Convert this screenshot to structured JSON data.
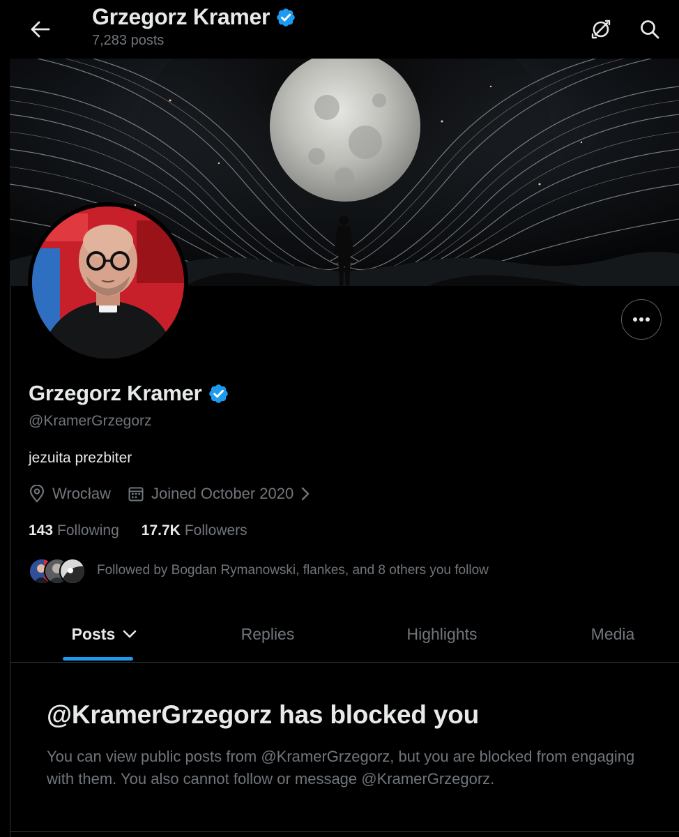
{
  "header": {
    "name": "Grzegorz Kramer",
    "post_count": "7,283 posts"
  },
  "profile": {
    "display_name": "Grzegorz Kramer",
    "handle": "@KramerGrzegorz",
    "bio": "jezuita prezbiter",
    "location": "Wrocław",
    "joined": "Joined October 2020",
    "following_count": "143",
    "following_label": "Following",
    "followers_count": "17.7K",
    "followers_label": "Followers",
    "followed_by": "Followed by Bogdan Rymanowski, flankes, and 8 others you follow",
    "verified": true
  },
  "tabs": [
    {
      "label": "Posts",
      "active": true
    },
    {
      "label": "Replies",
      "active": false
    },
    {
      "label": "Highlights",
      "active": false
    },
    {
      "label": "Media",
      "active": false
    }
  ],
  "blocked": {
    "title": "@KramerGrzegorz has blocked you",
    "message": "You can view public posts from @KramerGrzegorz, but you are blocked from engaging with them. You also cannot follow or message @KramerGrzegorz."
  },
  "colors": {
    "background": "#000000",
    "text_primary": "#e7e9ea",
    "text_secondary": "#71767b",
    "accent": "#1d9bf0",
    "verified_badge": "#1d9bf0"
  },
  "icons": {
    "back": "arrow-left-icon",
    "notifications_off": "bell-off-icon",
    "search": "search-icon",
    "more": "more-dots-icon",
    "location": "location-pin-icon",
    "calendar": "calendar-icon",
    "chevron_right": "chevron-right-icon",
    "chevron_down": "chevron-down-icon",
    "verified": "verified-badge-icon"
  }
}
